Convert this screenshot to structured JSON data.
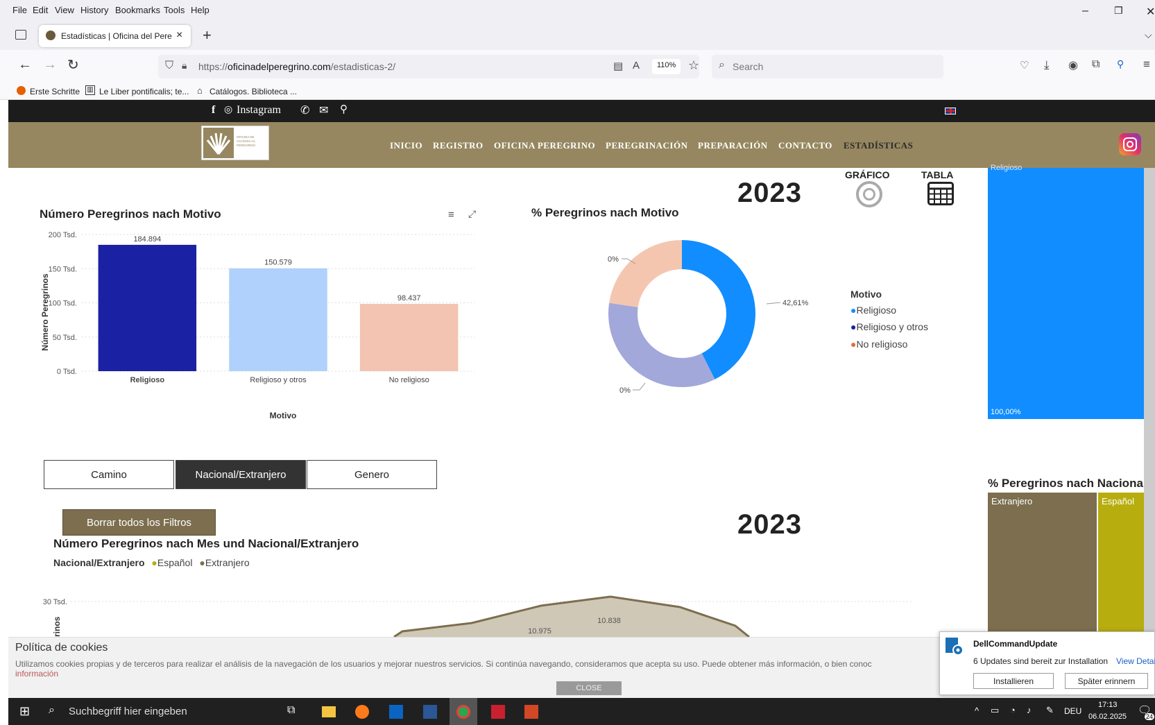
{
  "menu": {
    "file": "File",
    "edit": "Edit",
    "view": "View",
    "history": "History",
    "bookmarks": "Bookmarks",
    "tools": "Tools",
    "help": "Help"
  },
  "tab": {
    "title": "Estadísticas | Oficina del Peregri",
    "close": "×",
    "new": "+"
  },
  "url": {
    "prefix": "https://",
    "domain": "oficinadelperegrino.com",
    "path": "/estadisticas-2/",
    "zoom": "110%"
  },
  "search": {
    "placeholder": "Search"
  },
  "bookmarks_bar": [
    "Erste Schritte",
    "Le Liber pontificalis; te...",
    "Catálogos. Biblioteca ..."
  ],
  "site": {
    "instagram": "Instagram",
    "nav": [
      "INICIO",
      "REGISTRO",
      "OFICINA PEREGRINO",
      "PEREGRINACIÓN",
      "PREPARACIÓN",
      "CONTACTO",
      "ESTADÍSTICAS"
    ],
    "logo_text": "OFICINA DE ACOGIDA AL PEREGRINO"
  },
  "view_toggle": {
    "grafico": "GRÁFICO",
    "tabla": "TABLA"
  },
  "year1": "2023",
  "year2": "2023",
  "bar_chart": {
    "title": "Número Peregrinos nach Motivo",
    "ylabel": "Número Peregrinos",
    "xlabel": "Motivo",
    "ticks": [
      "200 Tsd.",
      "150 Tsd.",
      "100 Tsd.",
      "50 Tsd.",
      "0 Tsd."
    ],
    "labels": [
      "184.894",
      "150.579",
      "98.437"
    ]
  },
  "donut_chart": {
    "title": "% Peregrinos nach Motivo",
    "label_main": "42,61%",
    "label_top": "0%",
    "label_bottom": "0%",
    "legend_title": "Motivo",
    "legend": [
      "Religioso",
      "Religioso y otros",
      "No religioso"
    ]
  },
  "chart_data": [
    {
      "type": "bar",
      "title": "Número Peregrinos nach Motivo",
      "xlabel": "Motivo",
      "ylabel": "Número Peregrinos",
      "categories": [
        "Religioso",
        "Religioso y otros",
        "No religioso"
      ],
      "values": [
        184894,
        150579,
        98437
      ],
      "colors": [
        "#1a21a3",
        "#b0d1fb",
        "#f2c4b1"
      ],
      "ylim": [
        0,
        200000
      ],
      "grid": true
    },
    {
      "type": "pie",
      "title": "% Peregrinos nach Motivo",
      "categories": [
        "Religioso",
        "Religioso y otros",
        "No religioso"
      ],
      "values": [
        42.61,
        34.7,
        22.69
      ],
      "colors": [
        "#118dff",
        "#a2a8da",
        "#f4c6b0"
      ],
      "legend": "right"
    },
    {
      "type": "area",
      "title": "Número Peregrinos nach Mes und Nacional/Extranjero",
      "series": [
        {
          "name": "Español"
        },
        {
          "name": "Extranjero"
        }
      ],
      "data_labels": [
        "10.975",
        "10.838"
      ],
      "ytick_visible": "30 Tsd.",
      "colors": [
        "#b8ad0f",
        "#7c6e4e"
      ]
    }
  ],
  "side_chart": {
    "top_label_partial": "Religioso",
    "percent": "100,00%",
    "title": "% Peregrinos nach Naciona",
    "extranjero": "Extranjero",
    "espanol": "Español"
  },
  "filters": {
    "camino": "Camino",
    "nacional": "Nacional/Extranjero",
    "genero": "Genero",
    "reset": "Borrar todos los Filtros"
  },
  "area_chart": {
    "title": "Número Peregrinos nach Mes und Nacional/Extranjero",
    "legend_title": "Nacional/Extranjero",
    "legend": [
      "Español",
      "Extranjero"
    ],
    "tick": "30 Tsd.",
    "ylabel_partial": "rinos",
    "label_a": "10.975",
    "label_b": "10.838"
  },
  "cookie": {
    "title": "Política de cookies",
    "text": "Utilizamos cookies propias y de terceros para realizar el análisis de la navegación de los usuarios y mejorar nuestros servicios. Si continúa navegando, consideramos que acepta su uso. Puede obtener más información, o bien conoc",
    "link": "información",
    "close": "CLOSE"
  },
  "toast": {
    "app": "DellCommandUpdate",
    "message": "6 Updates sind bereit zur Installation",
    "link": "View Detail",
    "install": "Installieren",
    "later": "Später erinnern"
  },
  "taskbar": {
    "search": "Suchbegriff hier eingeben",
    "lang": "DEU",
    "time": "17:13",
    "date": "06.02.2025",
    "badge": "24"
  }
}
